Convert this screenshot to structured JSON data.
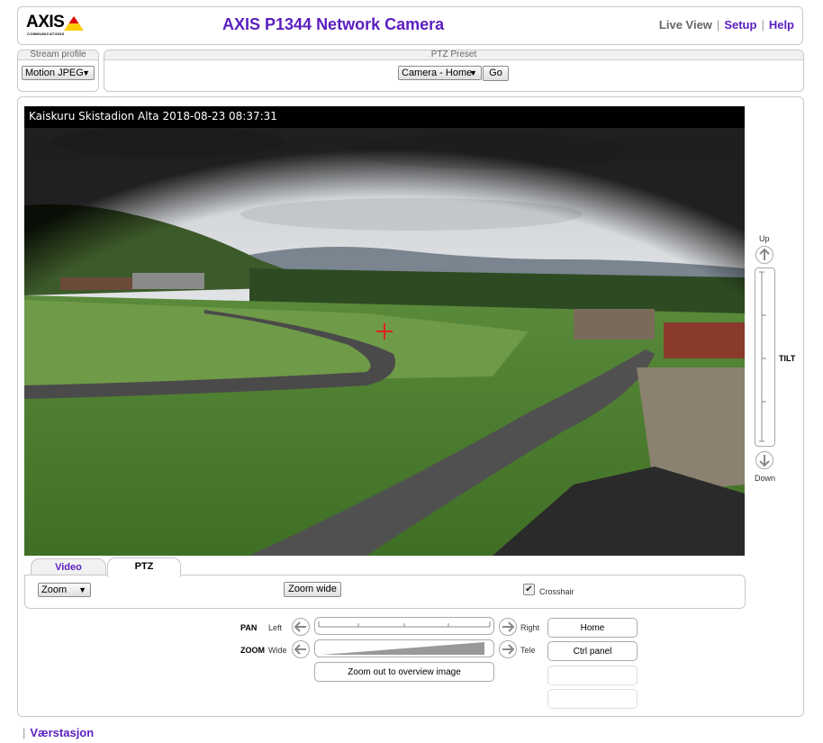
{
  "header": {
    "logo_text": "AXIS",
    "logo_subtext": "COMMUNICATIONS",
    "title": "AXIS P1344 Network Camera",
    "nav": {
      "live_view": "Live View",
      "setup": "Setup",
      "help": "Help"
    }
  },
  "stream_profile": {
    "label": "Stream profile",
    "value": "Motion JPEG"
  },
  "ptz_preset": {
    "label": "PTZ Preset",
    "value": "Camera - Home",
    "go_label": "Go"
  },
  "video": {
    "caption": "Kaiskuru Skistadion Alta 2018-08-23 08:37:31"
  },
  "tilt": {
    "up_label": "Up",
    "label": "TILT",
    "down_label": "Down"
  },
  "tabs": {
    "video": "Video",
    "ptz": "PTZ"
  },
  "ptz_panel": {
    "mode_value": "Zoom",
    "zoom_wide_button": "Zoom wide",
    "crosshair_label": "Crosshair",
    "crosshair_checked": true
  },
  "pan": {
    "label": "PAN",
    "left": "Left",
    "right": "Right"
  },
  "zoom": {
    "label": "ZOOM",
    "wide": "Wide",
    "tele": "Tele"
  },
  "buttons": {
    "home": "Home",
    "ctrl_panel": "Ctrl panel",
    "zoom_overview": "Zoom out to overview image"
  },
  "footer": {
    "link": "Værstasjon"
  },
  "colors": {
    "accent": "#5a1ec0",
    "crosshair": "#e02020"
  }
}
